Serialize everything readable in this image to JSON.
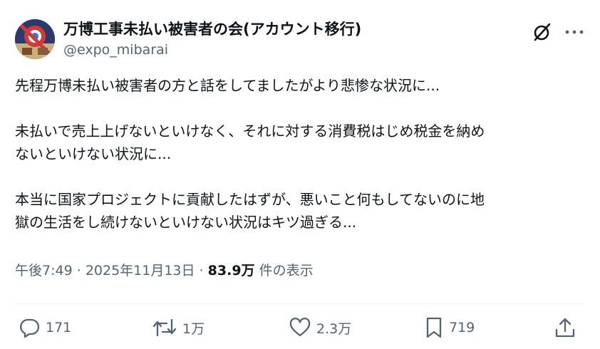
{
  "author": {
    "display_name": "万博工事未払い被害者の会(アカウント移行)",
    "handle": "@expo_mibarai",
    "avatar_icon": "avatar-image"
  },
  "header_icons": {
    "grok": "grok-icon",
    "more": "more-icon"
  },
  "tweet": {
    "paragraphs": [
      [
        "先程万博未払い被害者の方と話をしてましたがより悲惨な状況に..."
      ],
      [
        "未払いで売上上げないといけなく、それに対する消費税はじめ税金を納め",
        "ないといけない状況に..."
      ],
      [
        "本当に国家プロジェクトに貢献したはずが、悪いこと何もしてないのに地",
        "獄の生活をし続けないといけない状況はキツ過ぎる..."
      ]
    ]
  },
  "meta": {
    "time": "午後7:49",
    "separator": "·",
    "date": "2025年11月13日",
    "views_count": "83.9万",
    "views_label": "件の表示"
  },
  "actions": {
    "reply_count": "171",
    "retweet_count": "1万",
    "like_count": "2.3万",
    "bookmark_count": "719"
  },
  "colors": {
    "text": "#0f1419",
    "secondary": "#536471",
    "divider": "#eff3f4"
  }
}
